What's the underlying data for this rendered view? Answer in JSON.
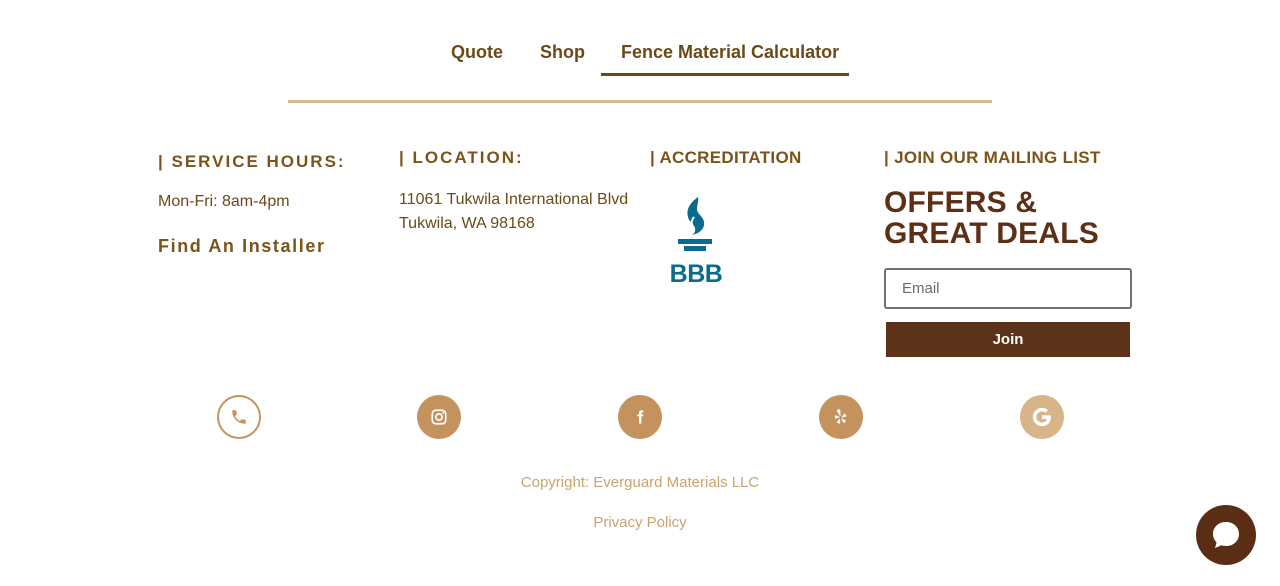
{
  "nav": {
    "items": [
      {
        "label": "Quote"
      },
      {
        "label": "Shop"
      },
      {
        "label": "Fence Material Calculator",
        "active": true
      }
    ]
  },
  "hours": {
    "heading": "| SERVICE HOURS:",
    "text": "Mon-Fri: 8am-4pm",
    "installer_link": "Find An Installer"
  },
  "location": {
    "heading": "| LOCATION:",
    "line1": "11061 Tukwila International Blvd",
    "line2": "Tukwila, WA 98168"
  },
  "accreditation": {
    "heading": "| ACCREDITATION",
    "logo_text": "BBB"
  },
  "mailing": {
    "heading": "| JOIN OUR MAILING LIST",
    "title": "OFFERS & GREAT DEALS",
    "email_placeholder": "Email",
    "join_label": "Join"
  },
  "social": [
    {
      "icon": "phone-icon"
    },
    {
      "icon": "instagram-icon"
    },
    {
      "icon": "facebook-icon"
    },
    {
      "icon": "yelp-icon"
    },
    {
      "icon": "google-icon"
    }
  ],
  "footer": {
    "copyright": "Copyright: Everguard Materials LLC",
    "privacy": "Privacy Policy"
  },
  "colors": {
    "brand_gold": "#c4935d",
    "brand_brown": "#5c3219",
    "text_brown": "#6b4a17",
    "divider": "#d8bb8b"
  }
}
